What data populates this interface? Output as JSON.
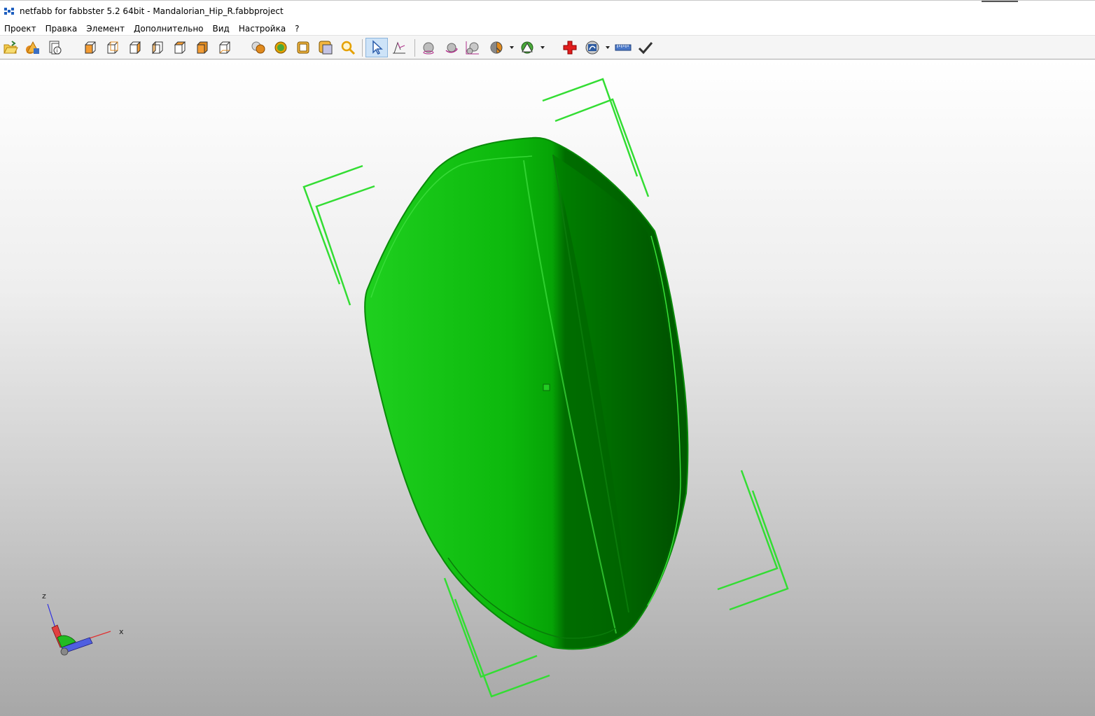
{
  "window": {
    "title": "netfabb for fabbster 5.2 64bit - Mandalorian_Hip_R.fabbproject"
  },
  "menu": {
    "items": [
      {
        "label": "Проект"
      },
      {
        "label": "Правка"
      },
      {
        "label": "Элемент"
      },
      {
        "label": "Дополнительно"
      },
      {
        "label": "Вид"
      },
      {
        "label": "Настройка"
      },
      {
        "label": "?"
      }
    ]
  },
  "toolbar": {
    "icons": [
      "open-folder-icon",
      "add-part-icon",
      "part-info-icon",
      "view-front-icon",
      "view-back-icon",
      "view-left-icon",
      "view-right-icon",
      "view-top-icon",
      "view-bottom-icon",
      "view-iso-icon",
      "shaded-view-icon",
      "color-view-icon",
      "wireframe-view-icon",
      "transparent-view-icon",
      "zoom-icon",
      "select-pointer-icon",
      "measure-triangle-icon",
      "sphere-icon",
      "rotate-sphere-icon",
      "scale-spheres-icon",
      "section-dropdown-icon",
      "cut-dropdown-icon",
      "repair-cross-icon",
      "analysis-dropdown-icon",
      "ruler-icon",
      "apply-check-icon"
    ],
    "active": "select-pointer-icon"
  },
  "viewport": {
    "part_color": "#00c000",
    "bounding_box_color": "#33dd33",
    "axis": {
      "x_label": "x",
      "z_label": "z",
      "x_color": "#e03030",
      "y_color": "#3030e0",
      "z_color": "#3030e0"
    }
  }
}
